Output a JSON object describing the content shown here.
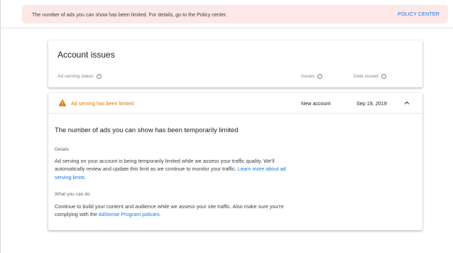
{
  "banner": {
    "message": "The number of ads you can show has been limited. For details, go to the Policy center.",
    "link": "POLICY CENTER"
  },
  "header": {
    "title": "Account issues",
    "columns": {
      "status": "Ad serving status",
      "issues": "Issues",
      "date": "Date issued"
    }
  },
  "issue": {
    "status": "Ad serving has been limited",
    "issues": "New account",
    "date": "Sep 19, 2019",
    "detail_title": "The number of ads you can show has been temporarily limited",
    "details_label": "Details",
    "details_text": "Ad serving on your account is being temporarily limited while we assess your traffic quality. We'll automatically review and update this limit as we continue to monitor your traffic. ",
    "details_link": "Learn more about ad serving limits.",
    "action_label": "What you can do",
    "action_text": "Continue to build your content and audience while we assess your site traffic. Also make sure you're complying with the ",
    "action_link": "AdSense Program policies",
    "action_end": "."
  },
  "colors": {
    "warning": "#e37400",
    "link": "#1a73e8",
    "banner_bg": "#fce8e6"
  },
  "icons": {
    "warning": "warning-triangle-icon",
    "help": "help-circle-icon",
    "collapse": "chevron-up-icon"
  }
}
